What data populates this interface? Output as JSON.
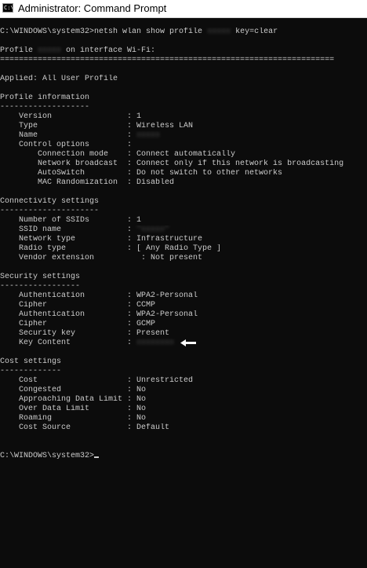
{
  "window": {
    "title": "Administrator: Command Prompt",
    "icon_name": "cmd-icon",
    "icon_glyph": "C:\\"
  },
  "console": {
    "prompt": "C:\\WINDOWS\\system32>",
    "command_before": "netsh wlan show profile ",
    "command_after": " key=clear",
    "profile_prefix": "Profile ",
    "profile_suffix": " on interface Wi-Fi:",
    "separator": "=======================================================================",
    "applied": "Applied: All User Profile",
    "sections": {
      "profile_info": {
        "heading": "Profile information",
        "underline": "-------------------",
        "rows": [
          {
            "label": "    Version                : ",
            "value": "1"
          },
          {
            "label": "    Type                   : ",
            "value": "Wireless LAN"
          },
          {
            "label": "    Name                   : ",
            "value": ""
          },
          {
            "label": "    Control options        : ",
            "value": ""
          },
          {
            "label": "        Connection mode    : ",
            "value": "Connect automatically"
          },
          {
            "label": "        Network broadcast  : ",
            "value": "Connect only if this network is broadcasting"
          },
          {
            "label": "        AutoSwitch         : ",
            "value": "Do not switch to other networks"
          },
          {
            "label": "        MAC Randomization  : ",
            "value": "Disabled"
          }
        ]
      },
      "connectivity": {
        "heading": "Connectivity settings",
        "underline": "---------------------",
        "rows": [
          {
            "label": "    Number of SSIDs        : ",
            "value": "1"
          },
          {
            "label": "    SSID name              : ",
            "value": ""
          },
          {
            "label": "    Network type           : ",
            "value": "Infrastructure"
          },
          {
            "label": "    Radio type             : ",
            "value": "[ Any Radio Type ]"
          },
          {
            "label": "    Vendor extension          : ",
            "value": "Not present"
          }
        ]
      },
      "security": {
        "heading": "Security settings",
        "underline": "-----------------",
        "rows": [
          {
            "label": "    Authentication         : ",
            "value": "WPA2-Personal"
          },
          {
            "label": "    Cipher                 : ",
            "value": "CCMP"
          },
          {
            "label": "    Authentication         : ",
            "value": "WPA2-Personal"
          },
          {
            "label": "    Cipher                 : ",
            "value": "GCMP"
          },
          {
            "label": "    Security key           : ",
            "value": "Present"
          },
          {
            "label": "    Key Content            : ",
            "value": ""
          }
        ]
      },
      "cost": {
        "heading": "Cost settings",
        "underline": "-------------",
        "rows": [
          {
            "label": "    Cost                   : ",
            "value": "Unrestricted"
          },
          {
            "label": "    Congested              : ",
            "value": "No"
          },
          {
            "label": "    Approaching Data Limit : ",
            "value": "No"
          },
          {
            "label": "    Over Data Limit        : ",
            "value": "No"
          },
          {
            "label": "    Roaming                : ",
            "value": "No"
          },
          {
            "label": "    Cost Source            : ",
            "value": "Default"
          }
        ]
      }
    }
  },
  "annotation": {
    "arrow_icon": "left-arrow-icon",
    "arrow_color": "#ffffff"
  },
  "colors": {
    "console_background": "#0c0c0c",
    "console_text": "#cccccc",
    "titlebar_background": "#ffffff",
    "title_text": "#000000"
  }
}
